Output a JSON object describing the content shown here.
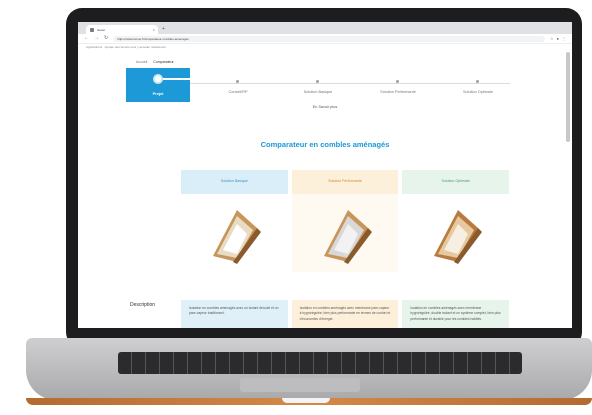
{
  "browser": {
    "tab_title": "Isover",
    "tab_close": "×",
    "new_tab": "+",
    "address": "https://www.isover.fr/comparateur-combles-amenages",
    "bookmarks_text": "Applications · Ajouter des favoris pour y accéder rapidement"
  },
  "breadcrumb": {
    "items": [
      "Accueil",
      "Comparateur"
    ]
  },
  "stepper": {
    "steps": [
      {
        "label": "Projet",
        "active": true
      },
      {
        "label": "Conseil/RP"
      },
      {
        "label": "Solution Basique"
      },
      {
        "label": "Solution Performante"
      },
      {
        "label": "Solution Optimale"
      }
    ]
  },
  "explain_link": "En Savoir plus",
  "page_title": "Comparateur en combles aménagés",
  "row_label": "Description",
  "columns": [
    {
      "header": "Solution Basique",
      "desc": "Isolation en combles aménagés avec un isolant déroulé et un pare-vapeur traditionnel."
    },
    {
      "header": "Solution Performante",
      "desc": "Isolation en combles aménagés avec membrane pare-vapeur à hygrorégulée, bien plus performante en termes de confort et d'économies d'énergie."
    },
    {
      "header": "Solution Optimale",
      "desc": "Isolation en combles aménagés avec membrane hygrorégulée, double isolant et un système complet, bien plus performante et durable pour les combles habités."
    }
  ],
  "colors": {
    "accent": "#1c99d6",
    "basic": "#d9eef8",
    "performance": "#fdf0da",
    "optimal": "#e6f4ec"
  }
}
